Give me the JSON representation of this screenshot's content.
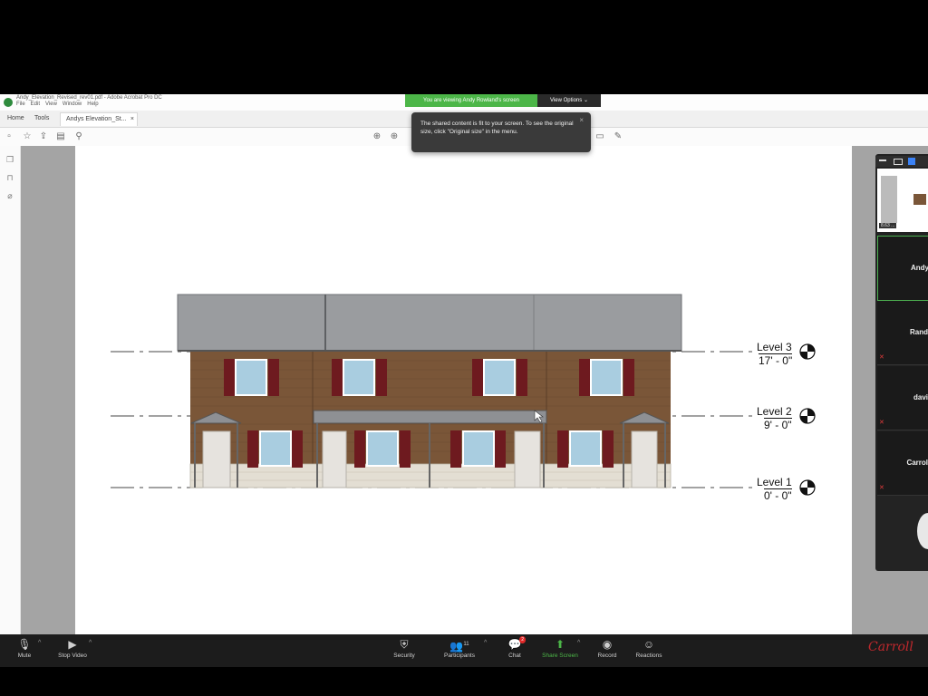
{
  "window": {
    "title": "Andy_Elevation_Revised_rev01.pdf - Adobe Acrobat Pro DC",
    "menu": [
      "File",
      "Edit",
      "View",
      "Window",
      "Help"
    ],
    "tabs": [
      {
        "label": "Home"
      },
      {
        "label": "Tools"
      },
      {
        "label": "Andys Elevation_St..."
      }
    ],
    "tab_close": "×"
  },
  "share_banner": {
    "status": "You are viewing Andy Rowland's screen",
    "view_options": "View Options ⌄"
  },
  "tooltip": {
    "text": "The shared content is fit to your screen. To see the original size, click \"Original size\" in the menu.",
    "close": "×"
  },
  "drawing": {
    "levels": [
      {
        "name": "Level 3",
        "elevation": "17' - 0\""
      },
      {
        "name": "Level 2",
        "elevation": "9' - 0\""
      },
      {
        "name": "Level 1",
        "elevation": "0' - 0\""
      }
    ],
    "colors": {
      "roof": "#9a9c9f",
      "siding": "#7a5638",
      "shutter": "#6e1a1f",
      "window": "#a9cde0",
      "stone": "#e3ded3",
      "door": "#e6e3de"
    }
  },
  "participants": [
    {
      "name": "Andy",
      "muted": false
    },
    {
      "name": "Rand",
      "muted": true
    },
    {
      "name": "davi",
      "muted": true
    },
    {
      "name": "Carrol",
      "muted": true
    }
  ],
  "participant_thumb_label": "8.63 ...",
  "zoom_bar": {
    "mute": "Mute",
    "stop_video": "Stop Video",
    "security": "Security",
    "participants": "Participants",
    "participant_count": "11",
    "chat": "Chat",
    "chat_badge": "2",
    "share_screen": "Share Screen",
    "record": "Record",
    "reactions": "Reactions"
  },
  "brand_logo": "Carroll"
}
